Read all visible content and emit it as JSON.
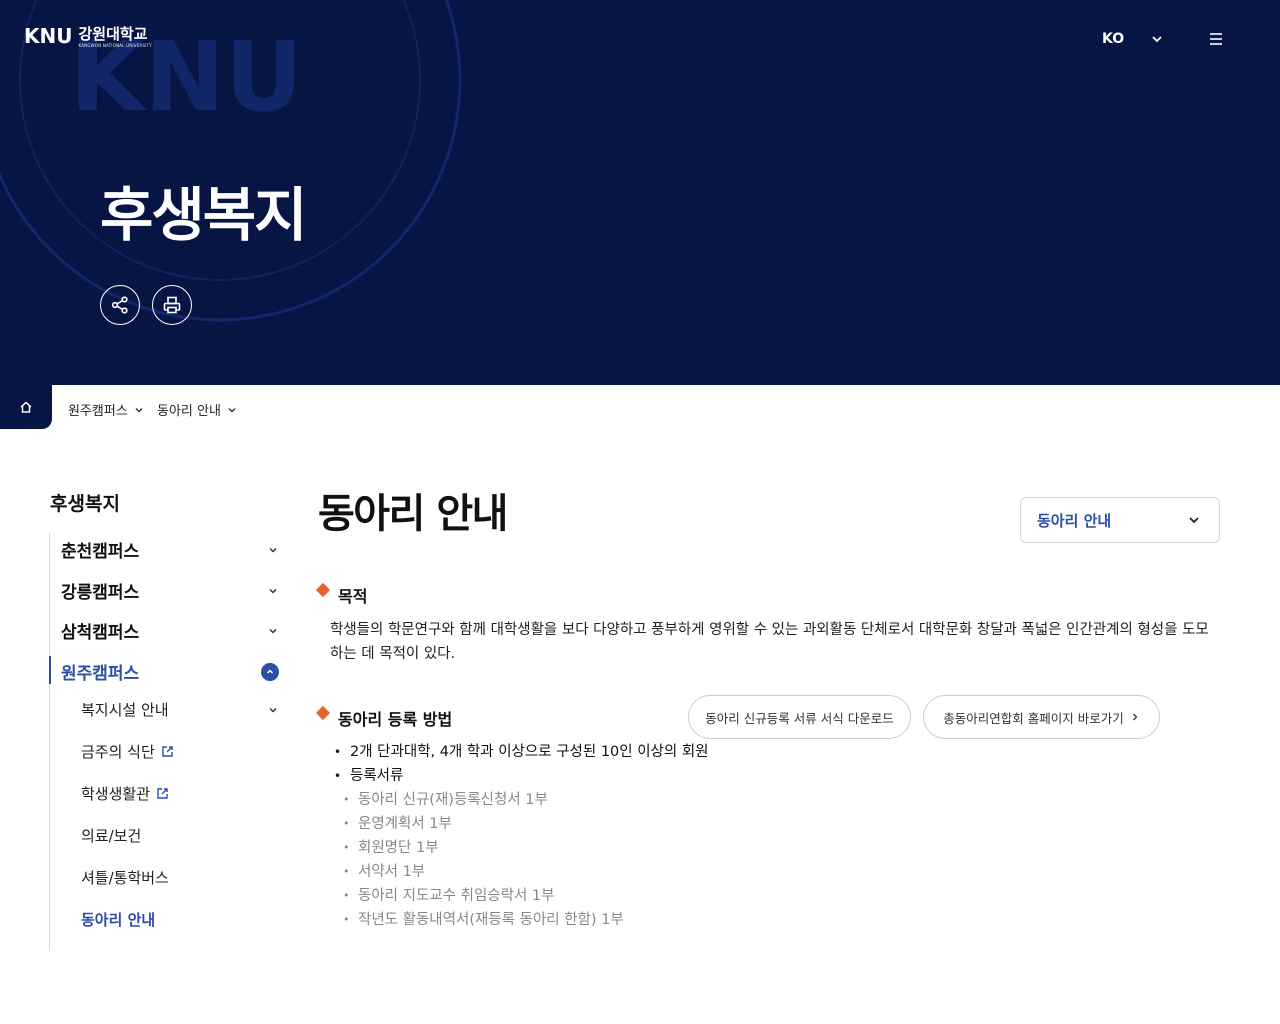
{
  "header": {
    "logo_mark": "KNU",
    "logo_kr": "강원대학교",
    "logo_en": "KANGWON NATIONAL UNIVERSITY",
    "lang": "KO",
    "hero_title": "후생복지"
  },
  "breadcrumb": {
    "items": [
      {
        "label": "원주캠퍼스"
      },
      {
        "label": "동아리 안내"
      }
    ]
  },
  "sidebar": {
    "title": "후생복지",
    "campuses": [
      {
        "label": "춘천캠퍼스"
      },
      {
        "label": "강릉캠퍼스"
      },
      {
        "label": "삼척캠퍼스"
      },
      {
        "label": "원주캠퍼스"
      }
    ],
    "sub_items": [
      {
        "label": "복지시설 안내"
      },
      {
        "label": "금주의 식단"
      },
      {
        "label": "학생생활관"
      },
      {
        "label": "의료/보건"
      },
      {
        "label": "셔틀/통학버스"
      },
      {
        "label": "동아리 안내"
      }
    ]
  },
  "main": {
    "title": "동아리 안내",
    "select_value": "동아리 안내",
    "section1": {
      "heading": "목적",
      "text": "학생들의 학문연구와 함께 대학생활을 보다 다양하고 풍부하게 영위할 수 있는 과외활동 단체로서 대학문화 창달과 폭넓은 인간관계의 형성을 도모하는 데 목적이 있다."
    },
    "section2": {
      "heading": "동아리 등록 방법",
      "button_download": "동아리 신규등록 서류 서식 다운로드",
      "button_homepage": "총동아리연합회 홈페이지 바로가기",
      "bullets": [
        "2개 단과대학, 4개 학과 이상으로 구성된 10인 이상의 회원",
        "등록서류"
      ],
      "documents": [
        "동아리 신규(재)등록신청서 1부",
        "운영계획서 1부",
        "회원명단 1부",
        "서약서 1부",
        "동아리 지도교수 취임승락서 1부",
        "작년도 활동내역서(재등록 동아리 한함) 1부"
      ]
    }
  },
  "colors": {
    "hero_bg": "#061544",
    "accent": "#2b4fa6",
    "bullet_diamond": "#e8622c"
  }
}
